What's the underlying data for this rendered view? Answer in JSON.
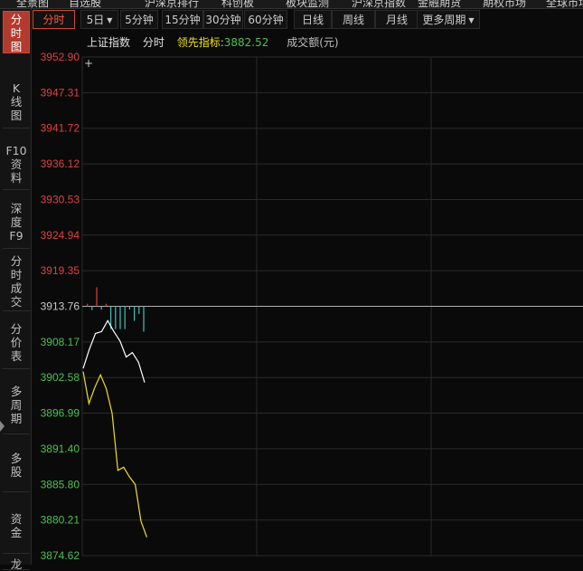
{
  "top_tabs": [
    "全景图",
    "自选股",
    "沪深京排行",
    "科创板",
    "板块监测",
    "沪深京指数",
    "金融期货",
    "期权市场",
    "全球市场"
  ],
  "sidebar": [
    {
      "label": "分时图",
      "active": true
    },
    {
      "label": "K线图",
      "active": false
    },
    {
      "label": "F10资料",
      "active": false
    },
    {
      "label": "深度F9",
      "active": false
    },
    {
      "label": "分时成交",
      "active": false
    },
    {
      "label": "分价表",
      "active": false
    },
    {
      "label": "多周期",
      "active": false
    },
    {
      "label": "多股",
      "active": false
    },
    {
      "label": "资金",
      "active": false
    },
    {
      "label": "龙",
      "active": false
    }
  ],
  "toolbar": [
    {
      "label": "分时",
      "active": true,
      "dropdown": false
    },
    {
      "label": "5日",
      "active": false,
      "dropdown": true
    },
    {
      "label": "5分钟",
      "active": false,
      "dropdown": false
    },
    {
      "label": "15分钟",
      "active": false,
      "dropdown": false
    },
    {
      "label": "30分钟",
      "active": false,
      "dropdown": false
    },
    {
      "label": "60分钟",
      "active": false,
      "dropdown": false
    },
    {
      "label": "日线",
      "active": false,
      "dropdown": false
    },
    {
      "label": "周线",
      "active": false,
      "dropdown": false
    },
    {
      "label": "月线",
      "active": false,
      "dropdown": false
    },
    {
      "label": "更多周期",
      "active": false,
      "dropdown": true
    }
  ],
  "info": {
    "index_name": "上证指数",
    "period": "分时",
    "leading_label": "领先指标:",
    "leading_value": "3882.52",
    "volume_label": "成交额(元)"
  },
  "chart_data": {
    "type": "line",
    "y_ticks": [
      "3952.90",
      "3947.31",
      "3941.72",
      "3936.12",
      "3930.53",
      "3924.94",
      "3919.35",
      "3913.76",
      "3908.17",
      "3902.58",
      "3896.99",
      "3891.40",
      "3885.80",
      "3880.21",
      "3874.62"
    ],
    "prev_close": 3913.76,
    "ylim": [
      3874.62,
      3952.9
    ],
    "series": [
      {
        "values": [
          3904.0,
          3907.0,
          3909.5,
          3909.8,
          3911.5,
          3909.8,
          3908.3,
          3905.8,
          3906.5,
          3905.0,
          3901.8
        ]
      },
      {
        "values": [
          3903.5,
          3898.5,
          3901.0,
          3903.0,
          3900.8,
          3897.0,
          3888.0,
          3888.5,
          3887.0,
          3885.8,
          3880.0,
          3877.5
        ]
      }
    ],
    "bars": [
      0.4,
      -0.6,
      3.0,
      -0.5,
      0.4,
      -3.6,
      -3.6,
      -3.6,
      -3.6,
      -0.5,
      -2.3,
      -1.2,
      -4.0
    ],
    "colors": {
      "up": "#e04040",
      "down": "#e04040",
      "price": "#ffffff",
      "avg": "#f0e020",
      "bar_up": "#e04040",
      "bar_down": "#40c0c0",
      "grid": "#2a2a2a",
      "mid": "#b0b0b0"
    }
  }
}
